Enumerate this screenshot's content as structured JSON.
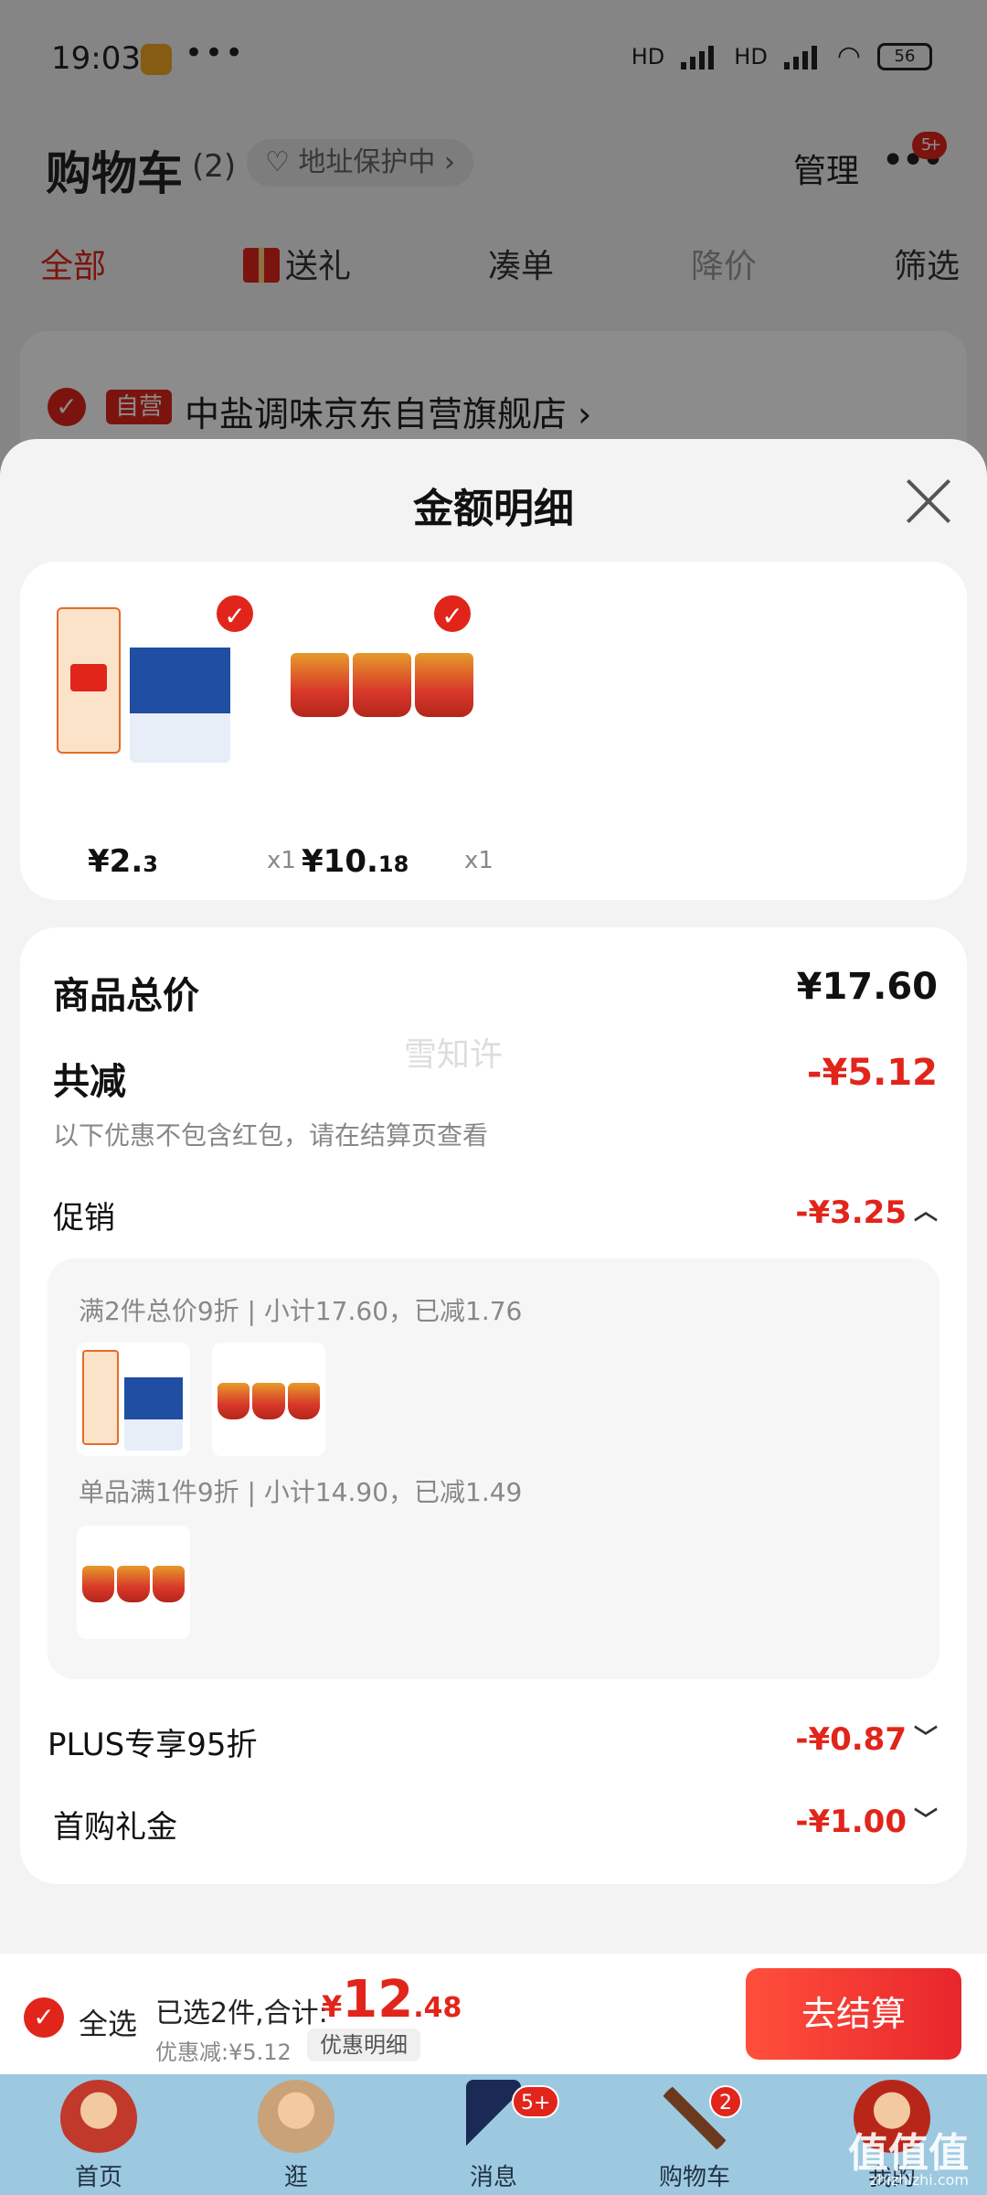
{
  "status_bar": {
    "time": "19:03",
    "dots": "•••",
    "network": "HD",
    "battery": "56"
  },
  "header": {
    "title": "购物车",
    "count": "(2)",
    "address_pill": "♡ 地址保护中 ›",
    "manage": "管理",
    "more_badge": "5+"
  },
  "filter_tabs": {
    "all": "全部",
    "gift": "送礼",
    "combine": "凑单",
    "price_drop": "降价",
    "filter": "筛选"
  },
  "store": {
    "tag": "自营",
    "name": "中盐调味京东自营旗舰店 ›"
  },
  "sheet": {
    "title": "金额明细",
    "products": [
      {
        "price_int": "¥2.",
        "price_dec": "3",
        "qty": "x1"
      },
      {
        "price_int": "¥10.",
        "price_dec": "18",
        "qty": "x1"
      }
    ],
    "total_label": "商品总价",
    "total_value": "¥17.60",
    "reduce_label": "共减",
    "reduce_value": "-¥5.12",
    "reduce_note": "以下优惠不包含红包，请在结算页查看",
    "promo_label": "促销",
    "promo_value": "-¥3.25",
    "promo_lines": [
      "满2件总价9折 | 小计17.60，已减1.76",
      "单品满1件9折 | 小计14.90，已减1.49"
    ],
    "plus_label": "PLUS专享95折",
    "plus_value": "-¥0.87",
    "first_label": "首购礼金",
    "first_value": "-¥1.00",
    "watermark": "雪知许"
  },
  "checkout": {
    "select_all": "全选",
    "selected_text": "已选2件,合计:",
    "price_symbol": "¥",
    "price_int": "12",
    "price_dec": ".48",
    "discount_text": "优惠减:¥5.12",
    "detail_button": "优惠明细",
    "checkout_button": "去结算"
  },
  "tabbar": {
    "items": [
      {
        "label": "首页",
        "badge": ""
      },
      {
        "label": "逛",
        "badge": ""
      },
      {
        "label": "消息",
        "badge": "5+"
      },
      {
        "label": "购物车",
        "badge": "2"
      },
      {
        "label": "我的",
        "badge": ""
      }
    ]
  },
  "site_mark": {
    "name": "值值值",
    "domain": "zhizhizhi.com"
  },
  "colors": {
    "accent": "#e1251b",
    "tabbar": "#9cc8e0"
  }
}
